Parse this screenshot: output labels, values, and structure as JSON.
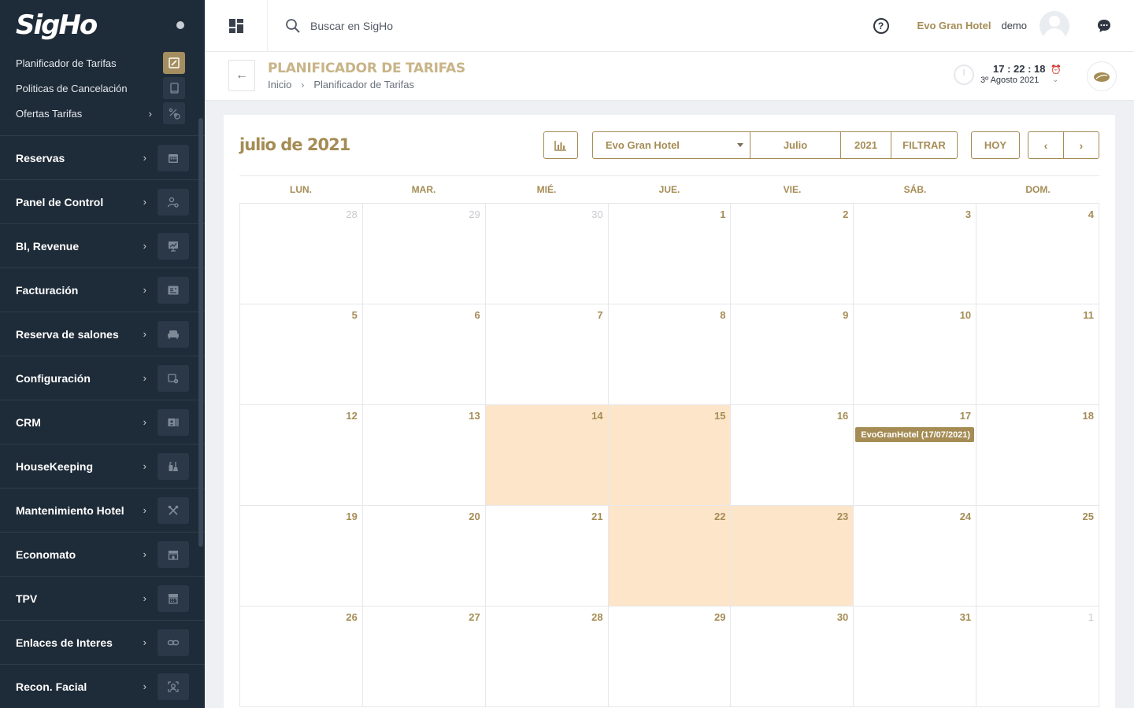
{
  "app": {
    "logo": "SigHo"
  },
  "sidebar": {
    "sub_items": [
      {
        "label": "Planificador de Tarifas",
        "icon": "edit-icon",
        "active": true,
        "has_chevron": false
      },
      {
        "label": "Politicas de Cancelación",
        "icon": "book-icon",
        "active": false,
        "has_chevron": false
      },
      {
        "label": "Ofertas Tarifas",
        "icon": "percent-tag-icon",
        "active": false,
        "has_chevron": true
      }
    ],
    "items": [
      {
        "label": "Reservas",
        "icon": "calendar-icon"
      },
      {
        "label": "Panel de Control",
        "icon": "user-gear-icon"
      },
      {
        "label": "BI, Revenue",
        "icon": "presentation-chart-icon"
      },
      {
        "label": "Facturación",
        "icon": "invoice-icon"
      },
      {
        "label": "Reserva de salones",
        "icon": "sofa-icon"
      },
      {
        "label": "Configuración",
        "icon": "settings-icon"
      },
      {
        "label": "CRM",
        "icon": "contact-card-icon"
      },
      {
        "label": "HouseKeeping",
        "icon": "cleaning-icon"
      },
      {
        "label": "Mantenimiento Hotel",
        "icon": "tools-icon"
      },
      {
        "label": "Economato",
        "icon": "store-icon"
      },
      {
        "label": "TPV",
        "icon": "register-icon"
      },
      {
        "label": "Enlaces de Interes",
        "icon": "link-icon"
      },
      {
        "label": "Recon. Facial",
        "icon": "face-scan-icon"
      }
    ]
  },
  "topbar": {
    "search_placeholder": "Buscar en SigHo",
    "hotel": "Evo Gran Hotel",
    "user": "demo"
  },
  "header": {
    "title": "PLANIFICADOR DE TARIFAS",
    "breadcrumb": [
      "Inicio",
      "Planificador de Tarifas"
    ],
    "time": "17 : 22 : 18",
    "date": "3º Agosto 2021"
  },
  "calendar": {
    "title": "julio de 2021",
    "filters": {
      "hotel": "Evo Gran Hotel",
      "month": "Julio",
      "year": "2021",
      "filter_label": "FILTRAR"
    },
    "today_label": "HOY",
    "prev_label": "‹",
    "next_label": "›",
    "weekdays": [
      "LUN.",
      "MAR.",
      "MIÉ.",
      "JUE.",
      "VIE.",
      "SÁB.",
      "DOM."
    ],
    "weeks": [
      [
        {
          "n": "28",
          "other": true
        },
        {
          "n": "29",
          "other": true
        },
        {
          "n": "30",
          "other": true
        },
        {
          "n": "1"
        },
        {
          "n": "2"
        },
        {
          "n": "3"
        },
        {
          "n": "4"
        }
      ],
      [
        {
          "n": "5"
        },
        {
          "n": "6"
        },
        {
          "n": "7"
        },
        {
          "n": "8"
        },
        {
          "n": "9"
        },
        {
          "n": "10"
        },
        {
          "n": "11"
        }
      ],
      [
        {
          "n": "12"
        },
        {
          "n": "13"
        },
        {
          "n": "14",
          "hl": true
        },
        {
          "n": "15",
          "hl": true
        },
        {
          "n": "16"
        },
        {
          "n": "17",
          "event": "EvoGranHotel (17/07/2021)"
        },
        {
          "n": "18"
        }
      ],
      [
        {
          "n": "19"
        },
        {
          "n": "20"
        },
        {
          "n": "21"
        },
        {
          "n": "22",
          "hl": true
        },
        {
          "n": "23",
          "hl": true
        },
        {
          "n": "24"
        },
        {
          "n": "25"
        }
      ],
      [
        {
          "n": "26"
        },
        {
          "n": "27"
        },
        {
          "n": "28"
        },
        {
          "n": "29"
        },
        {
          "n": "30"
        },
        {
          "n": "31"
        },
        {
          "n": "1",
          "other": true
        }
      ]
    ]
  },
  "colors": {
    "accent": "#a58c55",
    "sidebar_bg": "#1e2b38",
    "highlight_day": "#fde5c9"
  }
}
